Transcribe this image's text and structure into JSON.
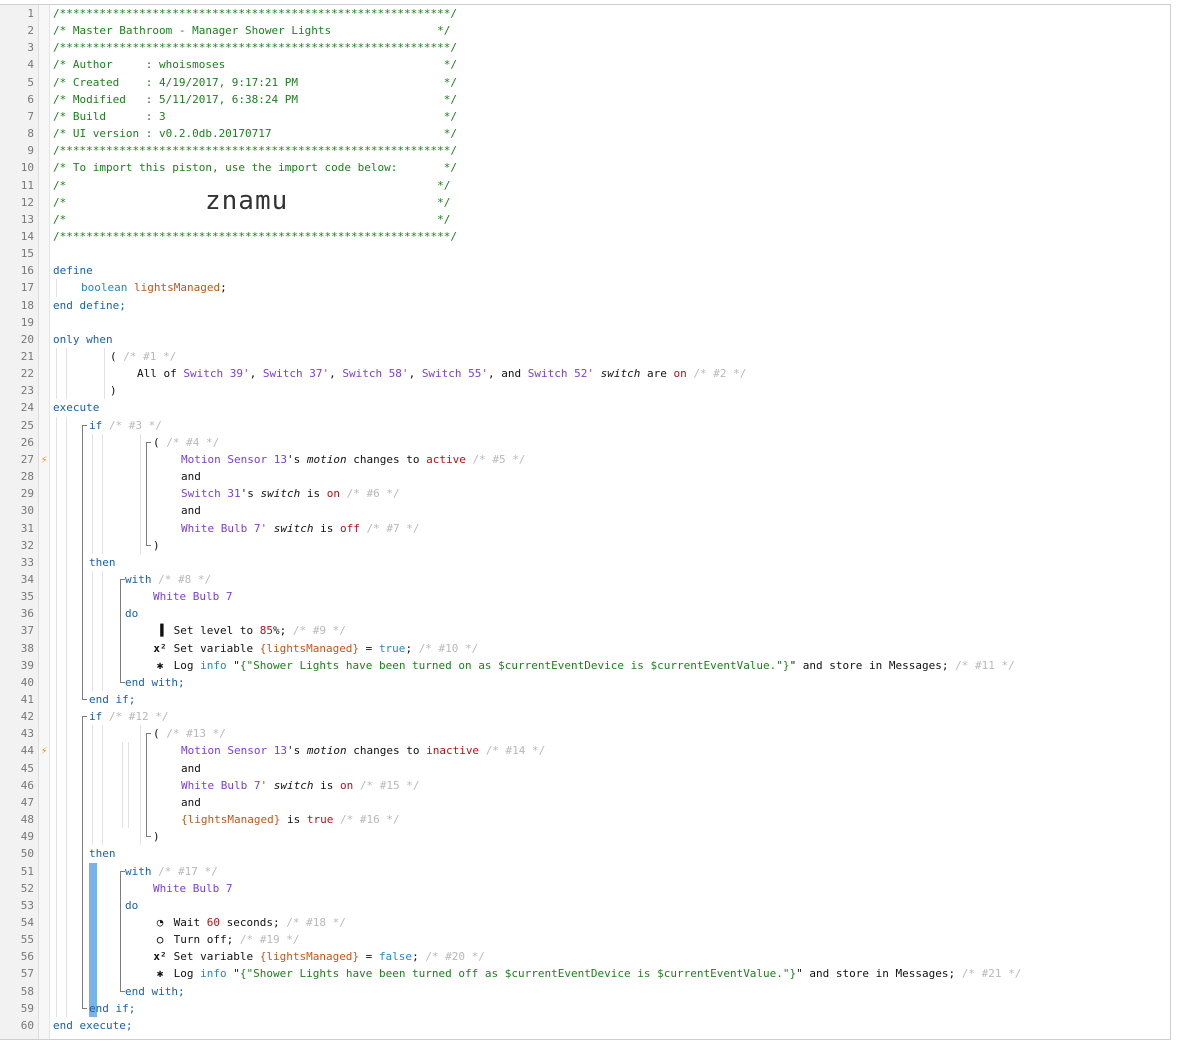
{
  "import_code": "znamu",
  "lines": [
    {
      "n": 1,
      "indent": 0,
      "segs": [
        [
          "cm",
          "/***********************************************************/"
        ]
      ]
    },
    {
      "n": 2,
      "indent": 0,
      "segs": [
        [
          "cm",
          "/* Master Bathroom - Manager Shower Lights                */"
        ]
      ]
    },
    {
      "n": 3,
      "indent": 0,
      "segs": [
        [
          "cm",
          "/***********************************************************/"
        ]
      ]
    },
    {
      "n": 4,
      "indent": 0,
      "segs": [
        [
          "cm",
          "/* Author     : whoismoses                                 */"
        ]
      ]
    },
    {
      "n": 5,
      "indent": 0,
      "segs": [
        [
          "cm",
          "/* Created    : 4/19/2017, 9:17:21 PM                      */"
        ]
      ]
    },
    {
      "n": 6,
      "indent": 0,
      "segs": [
        [
          "cm",
          "/* Modified   : 5/11/2017, 6:38:24 PM                      */"
        ]
      ]
    },
    {
      "n": 7,
      "indent": 0,
      "segs": [
        [
          "cm",
          "/* Build      : 3                                          */"
        ]
      ]
    },
    {
      "n": 8,
      "indent": 0,
      "segs": [
        [
          "cm",
          "/* UI version : v0.2.0db.20170717                          */"
        ]
      ]
    },
    {
      "n": 9,
      "indent": 0,
      "segs": [
        [
          "cm",
          "/***********************************************************/"
        ]
      ]
    },
    {
      "n": 10,
      "indent": 0,
      "segs": [
        [
          "cm",
          "/* To import this piston, use the import code below:       */"
        ]
      ]
    },
    {
      "n": 11,
      "indent": 0,
      "segs": [
        [
          "cm",
          "/*                                                        */"
        ]
      ]
    },
    {
      "n": 12,
      "indent": 0,
      "segs": [
        [
          "cm",
          "/*                                                        */"
        ]
      ]
    },
    {
      "n": 13,
      "indent": 0,
      "segs": [
        [
          "cm",
          "/*                                                        */"
        ]
      ]
    },
    {
      "n": 14,
      "indent": 0,
      "segs": [
        [
          "cm",
          "/***********************************************************/"
        ]
      ]
    },
    {
      "n": 15,
      "indent": 0,
      "segs": []
    },
    {
      "n": 16,
      "indent": 0,
      "segs": [
        [
          "kw",
          "define"
        ]
      ]
    },
    {
      "n": 17,
      "indent": 28,
      "segs": [
        [
          "ty",
          "boolean"
        ],
        [
          "tx",
          " "
        ],
        [
          "var",
          "lightsManaged"
        ],
        [
          "tx",
          ";"
        ]
      ]
    },
    {
      "n": 18,
      "indent": 0,
      "segs": [
        [
          "kw",
          "end define;"
        ]
      ]
    },
    {
      "n": 19,
      "indent": 0,
      "segs": []
    },
    {
      "n": 20,
      "indent": 0,
      "segs": [
        [
          "kw",
          "only when"
        ]
      ]
    },
    {
      "n": 21,
      "indent": 57,
      "segs": [
        [
          "tx",
          "( "
        ],
        [
          "note",
          "/* #1 */"
        ]
      ]
    },
    {
      "n": 22,
      "indent": 84,
      "segs": [
        [
          "tx",
          "All of "
        ],
        [
          "dev",
          "Switch 39'"
        ],
        [
          "tx",
          ", "
        ],
        [
          "dev",
          "Switch 37'"
        ],
        [
          "tx",
          ", "
        ],
        [
          "dev",
          "Switch 58'"
        ],
        [
          "tx",
          ", "
        ],
        [
          "dev",
          "Switch 55'"
        ],
        [
          "tx",
          ", and "
        ],
        [
          "dev",
          "Switch 52'"
        ],
        [
          "tx",
          " "
        ],
        [
          "attr",
          "switch"
        ],
        [
          "tx",
          " are "
        ],
        [
          "val",
          "on"
        ],
        [
          "tx",
          " "
        ],
        [
          "note",
          "/* #2 */"
        ]
      ]
    },
    {
      "n": 23,
      "indent": 57,
      "segs": [
        [
          "tx",
          ")"
        ]
      ]
    },
    {
      "n": 24,
      "indent": 0,
      "segs": [
        [
          "kw",
          "execute"
        ]
      ]
    },
    {
      "n": 25,
      "indent": 36,
      "segs": [
        [
          "kw",
          "if"
        ],
        [
          "tx",
          " "
        ],
        [
          "note",
          "/* #3 */"
        ]
      ]
    },
    {
      "n": 26,
      "indent": 100,
      "segs": [
        [
          "tx",
          "( "
        ],
        [
          "note",
          "/* #4 */"
        ]
      ]
    },
    {
      "n": 27,
      "indent": 128,
      "bolt": true,
      "segs": [
        [
          "dev",
          "Motion Sensor 13"
        ],
        [
          "tx",
          "'s "
        ],
        [
          "attr",
          "motion"
        ],
        [
          "tx",
          " changes to "
        ],
        [
          "val",
          "active"
        ],
        [
          "tx",
          " "
        ],
        [
          "note",
          "/* #5 */"
        ]
      ]
    },
    {
      "n": 28,
      "indent": 128,
      "segs": [
        [
          "tx",
          "and"
        ]
      ]
    },
    {
      "n": 29,
      "indent": 128,
      "segs": [
        [
          "dev",
          "Switch 31"
        ],
        [
          "tx",
          "'s "
        ],
        [
          "attr",
          "switch"
        ],
        [
          "tx",
          " is "
        ],
        [
          "val",
          "on"
        ],
        [
          "tx",
          " "
        ],
        [
          "note",
          "/* #6 */"
        ]
      ]
    },
    {
      "n": 30,
      "indent": 128,
      "segs": [
        [
          "tx",
          "and"
        ]
      ]
    },
    {
      "n": 31,
      "indent": 128,
      "segs": [
        [
          "dev",
          "White Bulb 7'"
        ],
        [
          "tx",
          " "
        ],
        [
          "attr",
          "switch"
        ],
        [
          "tx",
          " is "
        ],
        [
          "val",
          "off"
        ],
        [
          "tx",
          " "
        ],
        [
          "note",
          "/* #7 */"
        ]
      ]
    },
    {
      "n": 32,
      "indent": 100,
      "segs": [
        [
          "tx",
          ")"
        ]
      ]
    },
    {
      "n": 33,
      "indent": 36,
      "segs": [
        [
          "kw",
          "then"
        ]
      ]
    },
    {
      "n": 34,
      "indent": 72,
      "segs": [
        [
          "kw",
          "with"
        ],
        [
          "tx",
          " "
        ],
        [
          "note",
          "/* #8 */"
        ]
      ]
    },
    {
      "n": 35,
      "indent": 100,
      "segs": [
        [
          "dev",
          "White Bulb 7"
        ]
      ]
    },
    {
      "n": 36,
      "indent": 72,
      "segs": [
        [
          "kw",
          "do"
        ]
      ]
    },
    {
      "n": 37,
      "indent": 100,
      "icon": "signal-icon",
      "glyph": "▐",
      "segs": [
        [
          "tx",
          "Set level to "
        ],
        [
          "val",
          "85"
        ],
        [
          "tx",
          "%; "
        ],
        [
          "note",
          "/* #9 */"
        ]
      ]
    },
    {
      "n": 38,
      "indent": 100,
      "icon": "variable-icon",
      "glyph": "x²",
      "segs": [
        [
          "tx",
          "Set variable "
        ],
        [
          "var",
          "{lightsManaged}"
        ],
        [
          "tx",
          " = "
        ],
        [
          "ty",
          "true"
        ],
        [
          "tx",
          "; "
        ],
        [
          "note",
          "/* #10 */"
        ]
      ]
    },
    {
      "n": 39,
      "indent": 100,
      "icon": "bug-icon",
      "glyph": "✱",
      "segs": [
        [
          "tx",
          "Log "
        ],
        [
          "info",
          "info"
        ],
        [
          "tx",
          " \""
        ],
        [
          "str",
          "{\"Shower Lights have been turned on as $currentEventDevice is $currentEventValue.\"}"
        ],
        [
          "tx",
          "\" and store in Messages; "
        ],
        [
          "note",
          "/* #11 */"
        ]
      ]
    },
    {
      "n": 40,
      "indent": 72,
      "segs": [
        [
          "kw",
          "end with;"
        ]
      ]
    },
    {
      "n": 41,
      "indent": 36,
      "segs": [
        [
          "kw",
          "end if;"
        ]
      ]
    },
    {
      "n": 42,
      "indent": 36,
      "segs": [
        [
          "kw",
          "if"
        ],
        [
          "tx",
          " "
        ],
        [
          "note",
          "/* #12 */"
        ]
      ]
    },
    {
      "n": 43,
      "indent": 100,
      "segs": [
        [
          "tx",
          "( "
        ],
        [
          "note",
          "/* #13 */"
        ]
      ]
    },
    {
      "n": 44,
      "indent": 128,
      "bolt": true,
      "segs": [
        [
          "dev",
          "Motion Sensor 13"
        ],
        [
          "tx",
          "'s "
        ],
        [
          "attr",
          "motion"
        ],
        [
          "tx",
          " changes to "
        ],
        [
          "val",
          "inactive"
        ],
        [
          "tx",
          " "
        ],
        [
          "note",
          "/* #14 */"
        ]
      ]
    },
    {
      "n": 45,
      "indent": 128,
      "segs": [
        [
          "tx",
          "and"
        ]
      ]
    },
    {
      "n": 46,
      "indent": 128,
      "segs": [
        [
          "dev",
          "White Bulb 7'"
        ],
        [
          "tx",
          " "
        ],
        [
          "attr",
          "switch"
        ],
        [
          "tx",
          " is "
        ],
        [
          "val",
          "on"
        ],
        [
          "tx",
          " "
        ],
        [
          "note",
          "/* #15 */"
        ]
      ]
    },
    {
      "n": 47,
      "indent": 128,
      "segs": [
        [
          "tx",
          "and"
        ]
      ]
    },
    {
      "n": 48,
      "indent": 128,
      "segs": [
        [
          "var",
          "{lightsManaged}"
        ],
        [
          "tx",
          " is "
        ],
        [
          "val",
          "true"
        ],
        [
          "tx",
          " "
        ],
        [
          "note",
          "/* #16 */"
        ]
      ]
    },
    {
      "n": 49,
      "indent": 100,
      "segs": [
        [
          "tx",
          ")"
        ]
      ]
    },
    {
      "n": 50,
      "indent": 36,
      "segs": [
        [
          "kw",
          "then"
        ]
      ]
    },
    {
      "n": 51,
      "indent": 72,
      "segs": [
        [
          "kw",
          "with"
        ],
        [
          "tx",
          " "
        ],
        [
          "note",
          "/* #17 */"
        ]
      ]
    },
    {
      "n": 52,
      "indent": 100,
      "segs": [
        [
          "dev",
          "White Bulb 7"
        ]
      ]
    },
    {
      "n": 53,
      "indent": 72,
      "segs": [
        [
          "kw",
          "do"
        ]
      ]
    },
    {
      "n": 54,
      "indent": 100,
      "icon": "clock-icon",
      "glyph": "◔",
      "segs": [
        [
          "tx",
          "Wait "
        ],
        [
          "val",
          "60"
        ],
        [
          "tx",
          " seconds; "
        ],
        [
          "note",
          "/* #18 */"
        ]
      ]
    },
    {
      "n": 55,
      "indent": 100,
      "icon": "power-icon",
      "glyph": "○",
      "segs": [
        [
          "tx",
          "Turn off; "
        ],
        [
          "note",
          "/* #19 */"
        ]
      ]
    },
    {
      "n": 56,
      "indent": 100,
      "icon": "variable-icon",
      "glyph": "x²",
      "segs": [
        [
          "tx",
          "Set variable "
        ],
        [
          "var",
          "{lightsManaged}"
        ],
        [
          "tx",
          " = "
        ],
        [
          "ty",
          "false"
        ],
        [
          "tx",
          "; "
        ],
        [
          "note",
          "/* #20 */"
        ]
      ]
    },
    {
      "n": 57,
      "indent": 100,
      "icon": "bug-icon",
      "glyph": "✱",
      "segs": [
        [
          "tx",
          "Log "
        ],
        [
          "info",
          "info"
        ],
        [
          "tx",
          " \""
        ],
        [
          "str",
          "{\"Shower Lights have been turned off as $currentEventDevice is $currentEventValue.\"}"
        ],
        [
          "tx",
          "\" and store in Messages; "
        ],
        [
          "note",
          "/* #21 */"
        ]
      ]
    },
    {
      "n": 58,
      "indent": 72,
      "segs": [
        [
          "kw",
          "end with;"
        ]
      ]
    },
    {
      "n": 59,
      "indent": 36,
      "segs": [
        [
          "kw",
          "end if;"
        ]
      ]
    },
    {
      "n": 60,
      "indent": 0,
      "segs": [
        [
          "kw",
          "end execute;"
        ]
      ]
    }
  ]
}
